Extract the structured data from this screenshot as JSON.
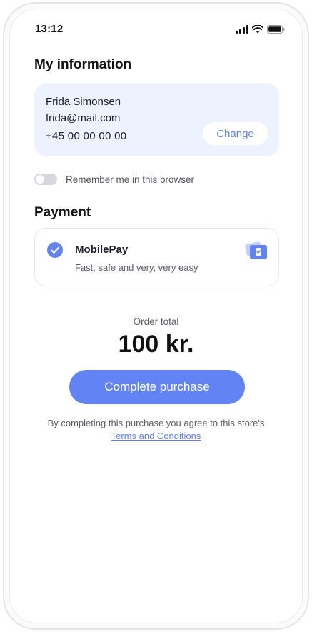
{
  "status_bar": {
    "time": "13:12",
    "icons": [
      "signal-icon",
      "wifi-icon",
      "battery-icon"
    ]
  },
  "my_information": {
    "title": "My information",
    "name": "Frida Simonsen",
    "email": "frida@mail.com",
    "phone": "+45 00 00 00 00",
    "change_label": "Change"
  },
  "remember": {
    "label": "Remember me in this browser",
    "enabled": false
  },
  "payment": {
    "title": "Payment",
    "method": "MobilePay",
    "description": "Fast, safe and very, very easy",
    "selected": true,
    "icons": [
      "check-icon",
      "wallet-icon"
    ]
  },
  "order": {
    "label": "Order total",
    "total": "100 kr."
  },
  "purchase_button": {
    "label": "Complete purchase"
  },
  "agreement": {
    "text": "By completing this purchase you agree to this store's",
    "link": "Terms and Conditions"
  },
  "colors": {
    "accent": "#6283f3",
    "card_bg": "#eef2fe",
    "link": "#5d7ff2"
  }
}
